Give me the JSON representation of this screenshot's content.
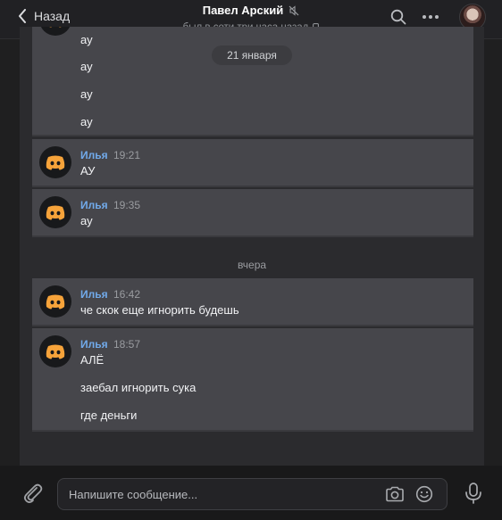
{
  "header": {
    "back_label": "Назад",
    "title": "Павел Арский",
    "status": "был в сети три часа назад"
  },
  "chat": {
    "top_block": {
      "lines": [
        "ау",
        "ау",
        "ау",
        "ау"
      ]
    },
    "date_pill": "21 января",
    "messages_day1": [
      {
        "author": "Илья",
        "time": "19:21",
        "lines": [
          "АУ"
        ]
      },
      {
        "author": "Илья",
        "time": "19:35",
        "lines": [
          "ау"
        ]
      }
    ],
    "date_separator": "вчера",
    "messages_day2": [
      {
        "author": "Илья",
        "time": "16:42",
        "lines": [
          "че скок еще игнорить будешь"
        ]
      },
      {
        "author": "Илья",
        "time": "18:57",
        "lines": [
          "АЛЁ",
          "заебал игнорить сука",
          "где деньги"
        ]
      }
    ]
  },
  "composer": {
    "placeholder": "Напишите сообщение..."
  },
  "colors": {
    "accent_name": "#71aaeb",
    "avatar_icon": "#f6a33a",
    "card_bg": "#46464b"
  },
  "icons": [
    "back-arrow-icon",
    "muted-icon",
    "phone-icon",
    "search-icon",
    "more-icon",
    "paperclip-icon",
    "camera-icon",
    "smile-icon",
    "microphone-icon"
  ]
}
